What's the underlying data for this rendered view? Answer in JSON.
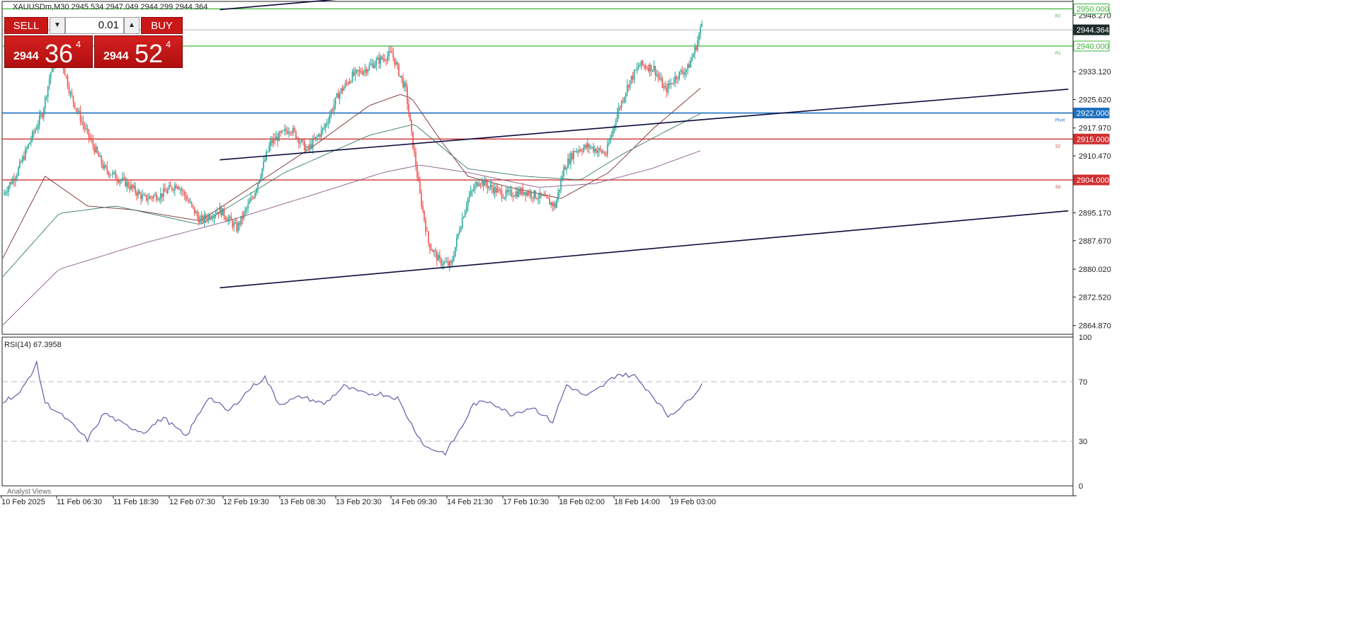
{
  "header": {
    "symbol_line": "XAUUSDm,M30  2945.534 2947.049 2944.299 2944.364"
  },
  "trade_panel": {
    "sell_label": "SELL",
    "buy_label": "BUY",
    "lot": "0.01",
    "sell_price_small": "2944",
    "sell_price_big": "36",
    "sell_price_sup": "4",
    "buy_price_small": "2944",
    "buy_price_big": "52",
    "buy_price_sup": "4"
  },
  "rsi_label": "RSI(14) 67.3958",
  "analyst_label": "Analyst Views",
  "colors": {
    "bull": "#26a69a",
    "bear": "#ef5350",
    "resistance": "#3cb43c",
    "pivot": "#1e6fbf",
    "support": "#d03030",
    "rsi": "#6a5aa8",
    "channel": "#0b0b3b",
    "ma_fast": "#7a2e2e",
    "ma_mid": "#3a7a6a",
    "ma_slow": "#8a5a8a"
  },
  "chart_data": [
    {
      "type": "candlestick",
      "title": "XAUUSDm,M30",
      "x_tick_labels": [
        "10 Feb 2025",
        "11 Feb 06:30",
        "11 Feb 18:30",
        "12 Feb 07:30",
        "12 Feb 19:30",
        "13 Feb 08:30",
        "13 Feb 20:30",
        "14 Feb 09:30",
        "14 Feb 21:30",
        "17 Feb 10:30",
        "18 Feb 02:00",
        "18 Feb 14:00",
        "19 Feb 03:00"
      ],
      "y_tick_labels": [
        "2948.270",
        "2933.120",
        "2925.620",
        "2917.970",
        "2910.470",
        "2895.170",
        "2887.670",
        "2880.020",
        "2872.520",
        "2864.870"
      ],
      "ylim": [
        2862.5,
        2952.0
      ],
      "current_price": 2944.364,
      "key_points": [
        {
          "x": 0,
          "y": 2900
        },
        {
          "x": 10,
          "y": 2906
        },
        {
          "x": 20,
          "y": 2915
        },
        {
          "x": 28,
          "y": 2922
        },
        {
          "x": 34,
          "y": 2933
        },
        {
          "x": 40,
          "y": 2939
        },
        {
          "x": 48,
          "y": 2927
        },
        {
          "x": 58,
          "y": 2918
        },
        {
          "x": 72,
          "y": 2907
        },
        {
          "x": 88,
          "y": 2903
        },
        {
          "x": 100,
          "y": 2899
        },
        {
          "x": 112,
          "y": 2900
        },
        {
          "x": 124,
          "y": 2903
        },
        {
          "x": 140,
          "y": 2893
        },
        {
          "x": 154,
          "y": 2896
        },
        {
          "x": 166,
          "y": 2891
        },
        {
          "x": 178,
          "y": 2900
        },
        {
          "x": 190,
          "y": 2914
        },
        {
          "x": 204,
          "y": 2918
        },
        {
          "x": 216,
          "y": 2912
        },
        {
          "x": 228,
          "y": 2918
        },
        {
          "x": 238,
          "y": 2927
        },
        {
          "x": 248,
          "y": 2932
        },
        {
          "x": 258,
          "y": 2934
        },
        {
          "x": 266,
          "y": 2936
        },
        {
          "x": 276,
          "y": 2938
        },
        {
          "x": 286,
          "y": 2928
        },
        {
          "x": 290,
          "y": 2916
        },
        {
          "x": 296,
          "y": 2900
        },
        {
          "x": 302,
          "y": 2887
        },
        {
          "x": 310,
          "y": 2882
        },
        {
          "x": 318,
          "y": 2881
        },
        {
          "x": 324,
          "y": 2891
        },
        {
          "x": 330,
          "y": 2899
        },
        {
          "x": 338,
          "y": 2904
        },
        {
          "x": 346,
          "y": 2902
        },
        {
          "x": 356,
          "y": 2900
        },
        {
          "x": 370,
          "y": 2901
        },
        {
          "x": 384,
          "y": 2899
        },
        {
          "x": 392,
          "y": 2897
        },
        {
          "x": 398,
          "y": 2907
        },
        {
          "x": 406,
          "y": 2912
        },
        {
          "x": 416,
          "y": 2913
        },
        {
          "x": 428,
          "y": 2911
        },
        {
          "x": 436,
          "y": 2922
        },
        {
          "x": 444,
          "y": 2930
        },
        {
          "x": 452,
          "y": 2935
        },
        {
          "x": 462,
          "y": 2934
        },
        {
          "x": 470,
          "y": 2928
        },
        {
          "x": 478,
          "y": 2932
        },
        {
          "x": 486,
          "y": 2934
        },
        {
          "x": 492,
          "y": 2940
        },
        {
          "x": 496,
          "y": 2946
        }
      ],
      "horizontal_levels": [
        {
          "label": "R2",
          "value": 2950.0
        },
        {
          "label": "R1",
          "value": 2940.0
        },
        {
          "label": "Pivot",
          "value": 2922.0
        },
        {
          "label": "S2",
          "value": 2915.0
        },
        {
          "label": "S3",
          "value": 2904.0
        }
      ],
      "level_price_labels": [
        "2950.000",
        "2944.364",
        "2940.000",
        "2922.000",
        "2915.000",
        "2904.000"
      ],
      "level_tags": [
        "R2",
        "R1",
        "Pivot",
        "S2",
        "S3"
      ],
      "channels": [
        {
          "name": "upper",
          "points": [
            {
              "x": 154,
              "y": 2949.8
            },
            {
              "x": 390,
              "y": 2957.6
            }
          ]
        },
        {
          "name": "middle",
          "points": [
            {
              "x": 154,
              "y": 2909.4
            },
            {
              "x": 756,
              "y": 2928.4
            }
          ]
        },
        {
          "name": "lower",
          "points": [
            {
              "x": 154,
              "y": 2875.0
            },
            {
              "x": 756,
              "y": 2895.7
            }
          ]
        }
      ],
      "moving_averages": [
        {
          "name": "fast",
          "points": [
            {
              "x": 0,
              "y": 2883
            },
            {
              "x": 30,
              "y": 2905
            },
            {
              "x": 60,
              "y": 2897
            },
            {
              "x": 92,
              "y": 2896
            },
            {
              "x": 140,
              "y": 2893
            },
            {
              "x": 180,
              "y": 2903
            },
            {
              "x": 220,
              "y": 2913
            },
            {
              "x": 260,
              "y": 2924
            },
            {
              "x": 282,
              "y": 2927
            },
            {
              "x": 290,
              "y": 2926
            },
            {
              "x": 310,
              "y": 2915
            },
            {
              "x": 330,
              "y": 2905
            },
            {
              "x": 360,
              "y": 2902
            },
            {
              "x": 396,
              "y": 2899
            },
            {
              "x": 430,
              "y": 2906
            },
            {
              "x": 462,
              "y": 2918
            },
            {
              "x": 496,
              "y": 2929
            }
          ]
        },
        {
          "name": "mid",
          "points": [
            {
              "x": 0,
              "y": 2878
            },
            {
              "x": 40,
              "y": 2895
            },
            {
              "x": 80,
              "y": 2897
            },
            {
              "x": 140,
              "y": 2892
            },
            {
              "x": 200,
              "y": 2906
            },
            {
              "x": 260,
              "y": 2916
            },
            {
              "x": 292,
              "y": 2919
            },
            {
              "x": 330,
              "y": 2907
            },
            {
              "x": 370,
              "y": 2905
            },
            {
              "x": 410,
              "y": 2904
            },
            {
              "x": 440,
              "y": 2911
            },
            {
              "x": 470,
              "y": 2917
            },
            {
              "x": 496,
              "y": 2922
            }
          ]
        },
        {
          "name": "slow",
          "points": [
            {
              "x": 0,
              "y": 2865
            },
            {
              "x": 40,
              "y": 2880
            },
            {
              "x": 100,
              "y": 2887
            },
            {
              "x": 160,
              "y": 2893
            },
            {
              "x": 220,
              "y": 2900
            },
            {
              "x": 270,
              "y": 2906
            },
            {
              "x": 296,
              "y": 2908
            },
            {
              "x": 330,
              "y": 2906
            },
            {
              "x": 380,
              "y": 2902
            },
            {
              "x": 420,
              "y": 2903
            },
            {
              "x": 460,
              "y": 2907
            },
            {
              "x": 496,
              "y": 2912
            }
          ]
        }
      ]
    },
    {
      "type": "line",
      "title": "RSI(14) 67.3958",
      "ylim": [
        0,
        100
      ],
      "y_tick_labels": [
        "100",
        "70",
        "30",
        "0"
      ],
      "reference_lines": [
        70,
        30
      ],
      "key_points": [
        {
          "x": 0,
          "y": 57
        },
        {
          "x": 12,
          "y": 62
        },
        {
          "x": 24,
          "y": 82
        },
        {
          "x": 30,
          "y": 56
        },
        {
          "x": 45,
          "y": 45
        },
        {
          "x": 60,
          "y": 31
        },
        {
          "x": 72,
          "y": 49
        },
        {
          "x": 86,
          "y": 41
        },
        {
          "x": 100,
          "y": 36
        },
        {
          "x": 114,
          "y": 46
        },
        {
          "x": 130,
          "y": 33
        },
        {
          "x": 146,
          "y": 60
        },
        {
          "x": 160,
          "y": 50
        },
        {
          "x": 176,
          "y": 66
        },
        {
          "x": 186,
          "y": 73
        },
        {
          "x": 196,
          "y": 55
        },
        {
          "x": 212,
          "y": 60
        },
        {
          "x": 228,
          "y": 55
        },
        {
          "x": 242,
          "y": 67
        },
        {
          "x": 256,
          "y": 62
        },
        {
          "x": 268,
          "y": 62
        },
        {
          "x": 280,
          "y": 59
        },
        {
          "x": 292,
          "y": 38
        },
        {
          "x": 300,
          "y": 26
        },
        {
          "x": 314,
          "y": 22
        },
        {
          "x": 326,
          "y": 40
        },
        {
          "x": 334,
          "y": 55
        },
        {
          "x": 346,
          "y": 57
        },
        {
          "x": 360,
          "y": 48
        },
        {
          "x": 376,
          "y": 53
        },
        {
          "x": 390,
          "y": 43
        },
        {
          "x": 400,
          "y": 68
        },
        {
          "x": 414,
          "y": 60
        },
        {
          "x": 424,
          "y": 66
        },
        {
          "x": 436,
          "y": 75
        },
        {
          "x": 448,
          "y": 74
        },
        {
          "x": 460,
          "y": 62
        },
        {
          "x": 472,
          "y": 47
        },
        {
          "x": 484,
          "y": 55
        },
        {
          "x": 496,
          "y": 68
        }
      ]
    }
  ]
}
